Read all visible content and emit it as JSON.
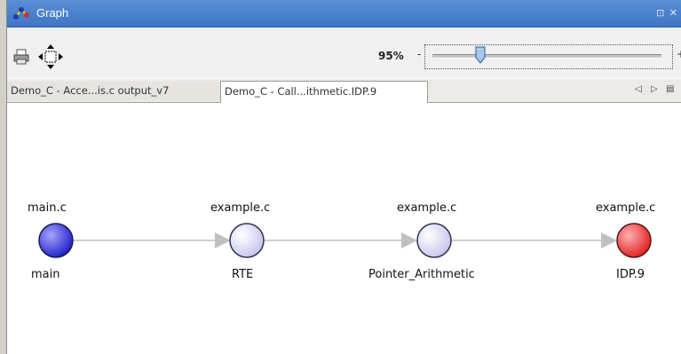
{
  "window": {
    "title": "Graph",
    "icon": "graph-icon",
    "controls_text": "⊡ ✕"
  },
  "toolbar": {
    "print_icon": "printer-icon",
    "pan_icon": "move-arrows-icon",
    "zoom_value": "95%",
    "zoom_fraction": 0.95,
    "slider_minus": "-",
    "slider_plus": "+"
  },
  "tabs": [
    {
      "label": "Demo_C - Acce...is.c output_v7",
      "active": false
    },
    {
      "label": "Demo_C - Call...ithmetic.IDP.9",
      "active": true
    }
  ],
  "tab_nav": {
    "left": "◁",
    "right": "▷",
    "menu": "▤"
  },
  "graph": {
    "nodes": [
      {
        "file": "example.c",
        "label": "RTE",
        "fill": "#d9d9f7",
        "stroke": "#33334d"
      },
      {
        "file": "main.c",
        "label": "main",
        "fill": "#3a3ae0",
        "stroke": "#1a1a4d"
      },
      {
        "file": "example.c",
        "label": "Pointer_Arithmetic",
        "fill": "#d9d9f7",
        "stroke": "#33334d"
      },
      {
        "file": "example.c",
        "label": "IDP.9",
        "fill": "#e83a3a",
        "stroke": "#4d1a1a"
      }
    ]
  },
  "colors": {
    "titlebar": "#4a80cc",
    "edge": "#bfbfbf",
    "arrow": "#c0c0c0"
  }
}
